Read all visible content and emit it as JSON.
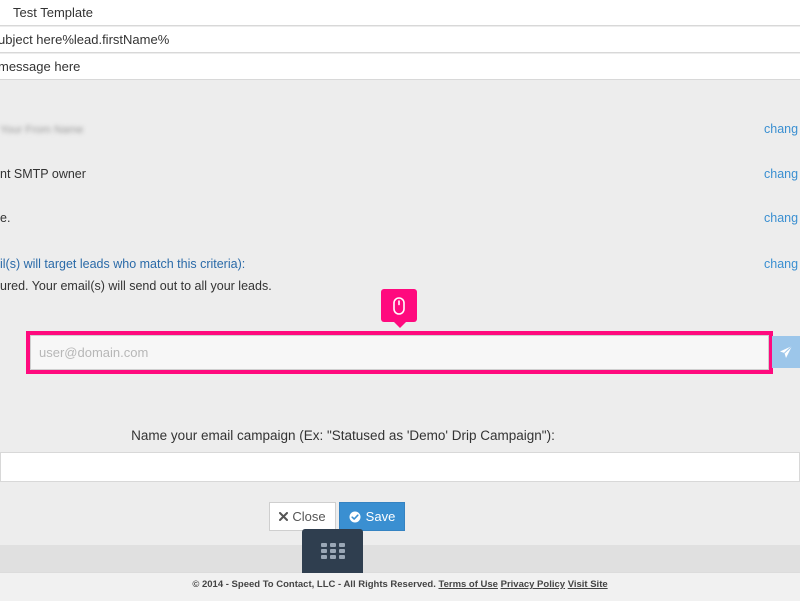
{
  "top_fields": {
    "template_name": "Test Template",
    "subject": "ubject here%lead.firstName%",
    "message": "message here"
  },
  "settings_rows": {
    "row1_label": "Your From Name",
    "row1_change": "chang",
    "row2_label": "nt SMTP owner",
    "row2_change": "chang",
    "row3_label": "e.",
    "row3_change": "chang",
    "row4_label": "il(s) will target leads who match this criteria):",
    "row4_sub": "ured. Your email(s) will send out to all your leads.",
    "row4_change": "chang"
  },
  "test_email": {
    "placeholder": "user@domain.com",
    "send_icon": "paper-plane-icon",
    "tooltip_icon": "mouse-icon"
  },
  "campaign": {
    "label": "Name your email campaign (Ex: \"Statused as 'Demo' Drip Campaign\"):",
    "value": ""
  },
  "actions": {
    "close_label": "Close",
    "close_icon": "x-icon",
    "save_label": "Save",
    "save_icon": "check-circle-icon",
    "grid_icon": "grid-icon"
  },
  "footer": {
    "copyright": "© 2014 - Speed To Contact, LLC - All Rights Reserved.",
    "terms_link": "Terms of Use",
    "privacy_link": "Privacy Policy",
    "visit_link": "Visit Site"
  },
  "colors": {
    "accent": "#3a8fd1",
    "highlight": "#ff0a7e",
    "dark": "#2f3e4f"
  }
}
